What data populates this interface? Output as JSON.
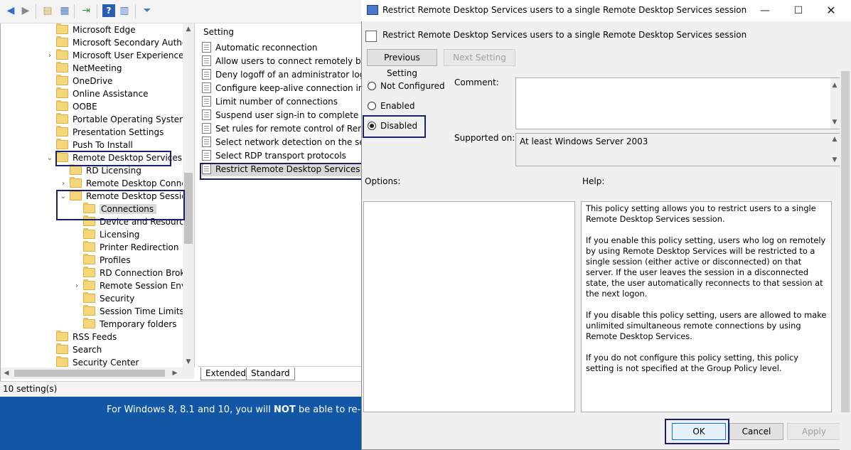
{
  "background_window": {
    "tree": [
      {
        "label": "Microsoft Edge",
        "indent": 0,
        "chevron": ""
      },
      {
        "label": "Microsoft Secondary Authent",
        "indent": 0,
        "chevron": ""
      },
      {
        "label": "Microsoft User Experience Vir",
        "indent": 0,
        "chevron": "›"
      },
      {
        "label": "NetMeeting",
        "indent": 0,
        "chevron": ""
      },
      {
        "label": "OneDrive",
        "indent": 0,
        "chevron": ""
      },
      {
        "label": "Online Assistance",
        "indent": 0,
        "chevron": ""
      },
      {
        "label": "OOBE",
        "indent": 0,
        "chevron": ""
      },
      {
        "label": "Portable Operating System",
        "indent": 0,
        "chevron": ""
      },
      {
        "label": "Presentation Settings",
        "indent": 0,
        "chevron": ""
      },
      {
        "label": "Push To Install",
        "indent": 0,
        "chevron": ""
      },
      {
        "label": "Remote Desktop Services",
        "indent": 0,
        "chevron": "⌄"
      },
      {
        "label": "RD Licensing",
        "indent": 1,
        "chevron": ""
      },
      {
        "label": "Remote Desktop Connect",
        "indent": 1,
        "chevron": "›"
      },
      {
        "label": "Remote Desktop Session I",
        "indent": 1,
        "chevron": "⌄"
      },
      {
        "label": "Connections",
        "indent": 2,
        "chevron": "",
        "selected": true
      },
      {
        "label": "Device and Resource R",
        "indent": 2,
        "chevron": ""
      },
      {
        "label": "Licensing",
        "indent": 2,
        "chevron": ""
      },
      {
        "label": "Printer Redirection",
        "indent": 2,
        "chevron": ""
      },
      {
        "label": "Profiles",
        "indent": 2,
        "chevron": ""
      },
      {
        "label": "RD Connection Broker",
        "indent": 2,
        "chevron": ""
      },
      {
        "label": "Remote Session Enviro",
        "indent": 2,
        "chevron": "›"
      },
      {
        "label": "Security",
        "indent": 2,
        "chevron": ""
      },
      {
        "label": "Session Time Limits",
        "indent": 2,
        "chevron": ""
      },
      {
        "label": "Temporary folders",
        "indent": 2,
        "chevron": ""
      },
      {
        "label": "RSS Feeds",
        "indent": 0,
        "chevron": ""
      },
      {
        "label": "Search",
        "indent": 0,
        "chevron": ""
      },
      {
        "label": "Security Center",
        "indent": 0,
        "chevron": ""
      }
    ],
    "settings_header": "Setting",
    "settings": [
      "Automatic reconnection",
      "Allow users to connect remotely by usi",
      "Deny logoff of an administrator logged",
      "Configure keep-alive connection interv",
      "Limit number of connections",
      "Suspend user sign-in to complete app",
      "Set rules for remote control of Remote",
      "Select network detection on the server",
      "Select RDP transport protocols",
      "Restrict Remote Desktop Services users"
    ],
    "tabs": {
      "extended": "Extended",
      "standard": "Standard"
    },
    "status": "10 setting(s)",
    "blue_text": {
      "before": "For Windows 8, 8.1 and 10, you will ",
      "bold": "NOT",
      "after": " be able to re-arm th"
    }
  },
  "dialog": {
    "title": "Restrict Remote Desktop Services users to a single Remote Desktop Services session",
    "header_title": "Restrict Remote Desktop Services users to a single Remote Desktop Services session",
    "prev_button": "Previous Setting",
    "next_button": "Next Setting",
    "radios": {
      "not_configured": "Not Configured",
      "enabled": "Enabled",
      "disabled": "Disabled"
    },
    "comment_label": "Comment:",
    "supported_label": "Supported on:",
    "supported_value": "At least Windows Server 2003",
    "options_label": "Options:",
    "help_label": "Help:",
    "help_paragraphs": [
      "This policy setting allows you to restrict users to a single Remote Desktop Services session.",
      "If you enable this policy setting, users who log on remotely by using Remote Desktop Services will be restricted to a single session (either active or disconnected) on that server. If the user leaves the session in a disconnected state, the user automatically reconnects to that session at the next logon.",
      "If you disable this policy setting, users are allowed to make unlimited simultaneous remote connections by using Remote Desktop Services.",
      "If you do not configure this policy setting,  this policy setting is not specified at the Group Policy level."
    ],
    "ok_button": "OK",
    "cancel_button": "Cancel",
    "apply_button": "Apply"
  }
}
